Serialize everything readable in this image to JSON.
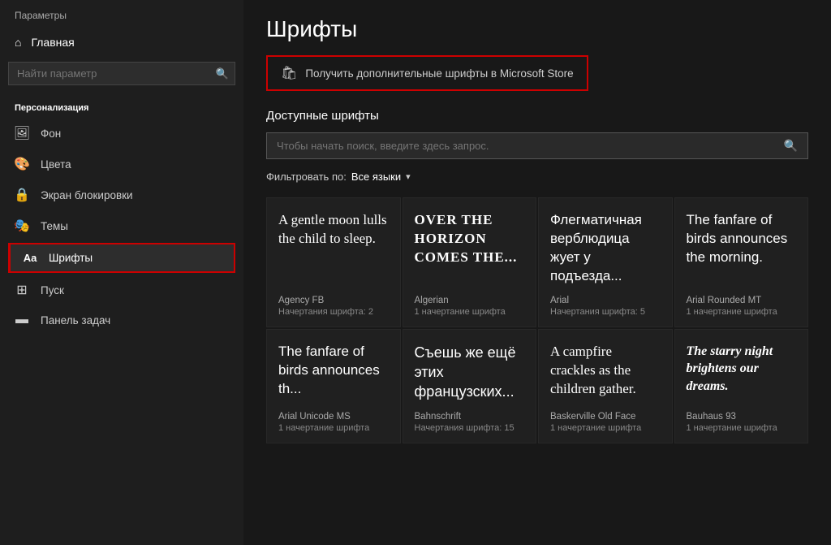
{
  "sidebar": {
    "app_title": "Параметры",
    "home_label": "Главная",
    "search_placeholder": "Найти параметр",
    "section_label": "Персонализация",
    "items": [
      {
        "id": "background",
        "label": "Фон",
        "icon": "🖼"
      },
      {
        "id": "colors",
        "label": "Цвета",
        "icon": "🎨"
      },
      {
        "id": "lockscreen",
        "label": "Экран блокировки",
        "icon": "🔒"
      },
      {
        "id": "themes",
        "label": "Темы",
        "icon": "🎭"
      },
      {
        "id": "fonts",
        "label": "Шрифты",
        "icon": "Aa",
        "active": true
      },
      {
        "id": "start",
        "label": "Пуск",
        "icon": "⊞"
      },
      {
        "id": "taskbar",
        "label": "Панель задач",
        "icon": "▬"
      }
    ]
  },
  "main": {
    "page_title": "Шрифты",
    "ms_store_btn": "Получить дополнительные шрифты в Microsoft Store",
    "available_fonts": "Доступные шрифты",
    "search_placeholder": "Чтобы начать поиск, введите здесь запрос.",
    "filter_label": "Фильтровать по:",
    "filter_value": "Все языки",
    "font_cards": [
      {
        "preview": "A gentle moon lulls the child to sleep.",
        "preview_style": "normal",
        "font_name": "Agency FB",
        "styles_label": "Начертания шрифта:",
        "styles_count": "2"
      },
      {
        "preview": "OVER THE HORIZON COMES THE...",
        "preview_style": "algerian",
        "font_name": "Algerian",
        "styles_label": "1 начертание шрифта",
        "styles_count": ""
      },
      {
        "preview": "Флегматичная верблюдица жует у подъезда...",
        "preview_style": "arial-cyrillic",
        "font_name": "Arial",
        "styles_label": "Начертания шрифта:",
        "styles_count": "5"
      },
      {
        "preview": "The fanfare of birds announces the morning.",
        "preview_style": "arial-rounded",
        "font_name": "Arial Rounded MT",
        "styles_label": "1 начертание шрифта",
        "styles_count": ""
      },
      {
        "preview": "The fanfare of birds announces th...",
        "preview_style": "arial-unicode",
        "font_name": "Arial Unicode MS",
        "styles_label": "1 начертание шрифта",
        "styles_count": ""
      },
      {
        "preview": "Съешь же ещё этих французских...",
        "preview_style": "bahnschrift",
        "font_name": "Bahnschrift",
        "styles_label": "Начертания шрифта:",
        "styles_count": "15"
      },
      {
        "preview": "A campfire crackles as the children gather.",
        "preview_style": "baskerville",
        "font_name": "Baskerville Old Face",
        "styles_label": "1 начертание шрифта",
        "styles_count": ""
      },
      {
        "preview": "The starry night brightens our dreams.",
        "preview_style": "bauhaus",
        "font_name": "Bauhaus 93",
        "styles_label": "1 начертание шрифта",
        "styles_count": ""
      }
    ]
  }
}
